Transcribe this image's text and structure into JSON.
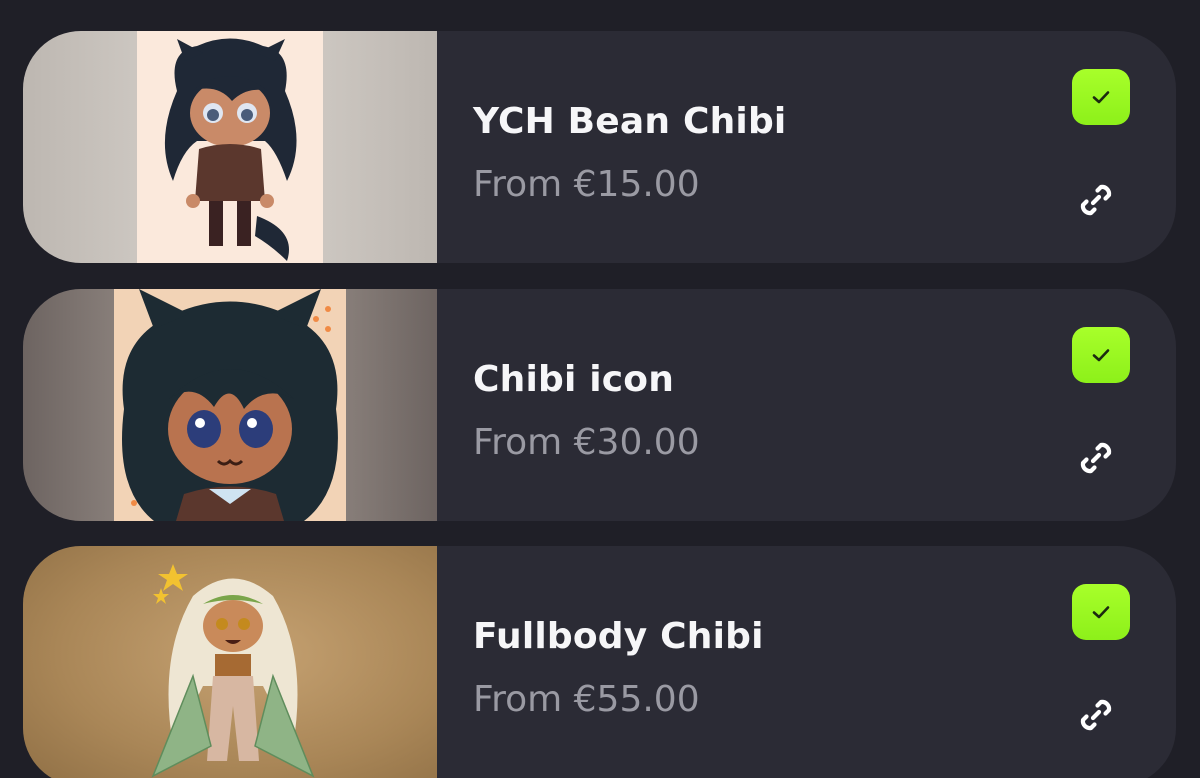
{
  "commissions": [
    {
      "title": "YCH Bean Chibi",
      "price": "From €15.00",
      "enabled": true,
      "thumbnail_icon": "chibi-character-thumbnail"
    },
    {
      "title": "Chibi icon",
      "price": "From €30.00",
      "enabled": true,
      "thumbnail_icon": "chibi-icon-thumbnail"
    },
    {
      "title": "Fullbody Chibi",
      "price": "From €55.00",
      "enabled": true,
      "thumbnail_icon": "fullbody-chibi-thumbnail"
    }
  ],
  "colors": {
    "background": "#1f1f27",
    "card": "#2b2b35",
    "title": "#f6f6f8",
    "price": "#9a9aa3",
    "check_accent": "#a8ff2a"
  },
  "icons": {
    "toggle": "checkmark-icon",
    "share": "link-icon"
  }
}
